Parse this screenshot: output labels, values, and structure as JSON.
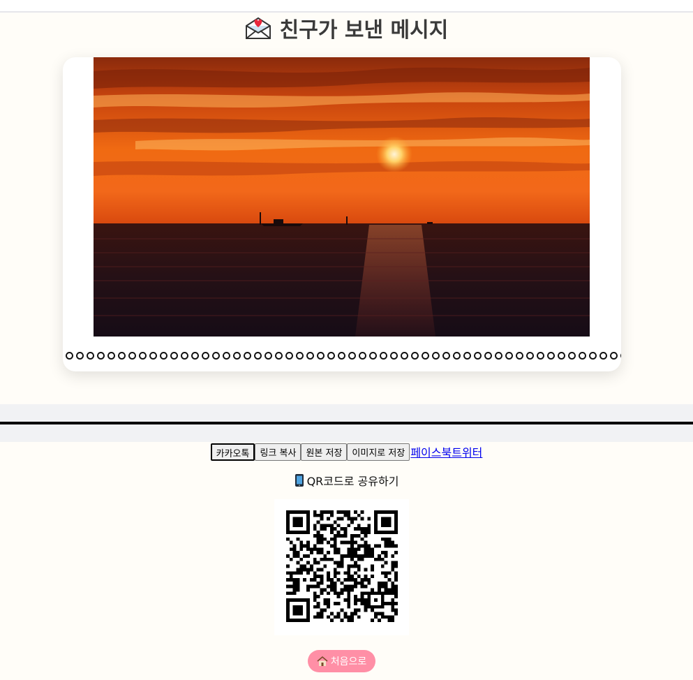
{
  "header": {
    "title_icon": "love-letter-icon",
    "title": "친구가 보낸 메시지"
  },
  "card": {
    "image": "sunset-over-sea-photo",
    "divider": "ring-dots-border"
  },
  "share": {
    "kakao_label": "카카오톡",
    "copy_link_label": "링크 복사",
    "save_original_label": "원본 저장",
    "save_image_label": "이미지로 저장",
    "facebook_label": "페이스북",
    "twitter_label": "트위터"
  },
  "qr": {
    "icon": "mobile-phone-icon",
    "label": "QR코드로 공유하기"
  },
  "home": {
    "icon": "house-icon",
    "label": "처음으로"
  },
  "colors": {
    "background": "#fffdf8",
    "home_button": "#ff8fa6",
    "link": "#0000ee"
  }
}
